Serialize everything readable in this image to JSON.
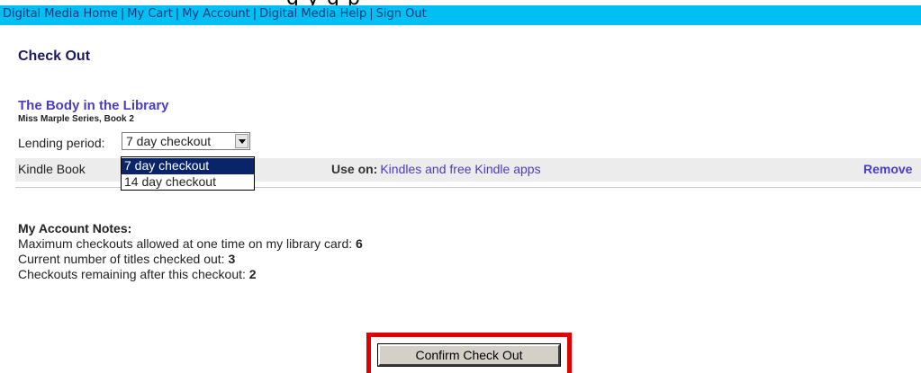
{
  "nav": {
    "items": [
      "Digital Media Home",
      "My Cart",
      "My Account",
      "Digital Media Help",
      "Sign Out"
    ],
    "separator": "|"
  },
  "page": {
    "title": "Check Out"
  },
  "item": {
    "title": "The Body in the Library",
    "series": "Miss Marple Series, Book 2",
    "lending_label": "Lending period:",
    "lending_value": "7 day checkout",
    "lending_options": [
      "7 day checkout",
      "14 day checkout"
    ],
    "format": "Kindle Book",
    "use_on_label": "Use on:",
    "use_on_link": "Kindles and free Kindle apps",
    "remove_label": "Remove"
  },
  "notes": {
    "heading": "My Account Notes:",
    "max_label": "Maximum checkouts allowed at one time on my library card:",
    "max_value": "6",
    "current_label": "Current number of titles checked out:",
    "current_value": "3",
    "remaining_label": "Checkouts remaining after this checkout:",
    "remaining_value": "2"
  },
  "actions": {
    "confirm_label": "Confirm Check Out"
  },
  "colors": {
    "navbar": "#00bff3",
    "link": "#4b3cc4",
    "highlight": "#e00000",
    "selected_option": "#0a246a"
  }
}
